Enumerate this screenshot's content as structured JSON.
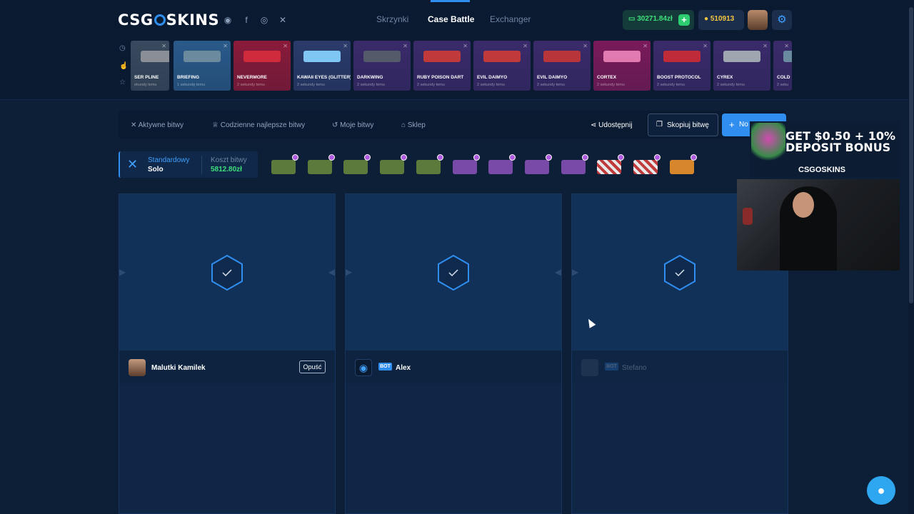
{
  "header": {
    "logo": "CSGOSKINS",
    "social": [
      "discord-icon",
      "facebook-icon",
      "instagram-icon",
      "x-icon"
    ],
    "nav": [
      {
        "label": "Skrzynki",
        "active": false
      },
      {
        "label": "Case Battle",
        "active": true
      },
      {
        "label": "Exchanger",
        "active": false
      }
    ],
    "balance": "30271.84zł",
    "coins": "510913"
  },
  "drops": [
    {
      "name": "SER PLINE",
      "time": "ekundy temu",
      "color": "#3a4a5e",
      "gun": "#8a8f96"
    },
    {
      "name": "BRIEFING",
      "time": "1 sekundę temu",
      "color": "#2a5a8a",
      "gun": "#6b8a9e"
    },
    {
      "name": "NEVERMORE",
      "time": "2 sekundy temu",
      "color": "#8a1a3a",
      "gun": "#d02b3c"
    },
    {
      "name": "KAWAII EYES (GLITTER)",
      "time": "2 sekundy temu",
      "color": "#2a3a6a",
      "gun": "#7fc6f5"
    },
    {
      "name": "DARKWING",
      "time": "2 sekundy temu",
      "color": "#3a2a6a",
      "gun": "#555a6a"
    },
    {
      "name": "RUBY POISON DART",
      "time": "2 sekundy temu",
      "color": "#3a2a6a",
      "gun": "#c0393b"
    },
    {
      "name": "EVIL DAIMYO",
      "time": "2 sekundy temu",
      "color": "#3a2a6a",
      "gun": "#c0393b"
    },
    {
      "name": "EVIL DAIMYO",
      "time": "2 sekundy temu",
      "color": "#3a2a6a",
      "gun": "#b8353a"
    },
    {
      "name": "CORTEX",
      "time": "2 sekundy temu",
      "color": "#7a1a5a",
      "gun": "#e07ab0"
    },
    {
      "name": "BOOST PROTOCOL",
      "time": "2 sekundy temu",
      "color": "#3a2a6a",
      "gun": "#c02b3a"
    },
    {
      "name": "CYREX",
      "time": "2 sekundy temu",
      "color": "#3a2a6a",
      "gun": "#a0a6b0"
    },
    {
      "name": "COLD",
      "time": "2 seku",
      "color": "#3a2a6a",
      "gun": "#6a8aa0"
    }
  ],
  "toolbar": {
    "active_battles": "Aktywne bitwy",
    "daily_best": "Codzienne najlepsze bitwy",
    "my_battles": "Moje bitwy",
    "shop": "Sklep",
    "share": "Udostępnij",
    "copy": "Skopiuj bitwę",
    "new": "No"
  },
  "battle": {
    "mode_label": "Standardowy",
    "mode_value": "Solo",
    "cost_label": "Koszt bitwy",
    "cost_value": "5812.80zł",
    "cases": [
      "green",
      "green",
      "green",
      "green",
      "green",
      "purple",
      "purple",
      "purple",
      "purple",
      "striped",
      "striped",
      "orange"
    ]
  },
  "players": [
    {
      "name": "Malutki Kamilek",
      "leave": "Opuść",
      "bot": false
    },
    {
      "name": "Alex",
      "bot": true,
      "bot_label": "BOT"
    },
    {
      "name": "Stefano",
      "bot": true,
      "bot_label": "BOT",
      "faded": true
    }
  ],
  "promo": {
    "headline": "GET $0.50 + 10% DEPOSIT BONUS",
    "brand": "CSGOSKINS"
  },
  "colors": {
    "accent": "#2f8ef0",
    "money": "#3ee07a",
    "bg": "#0d1f37"
  }
}
